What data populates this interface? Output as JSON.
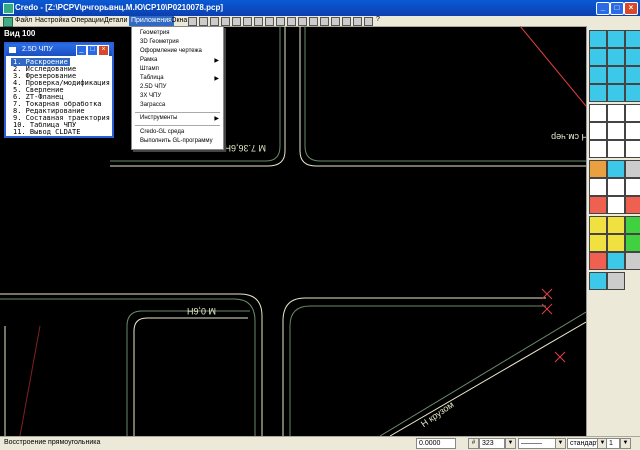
{
  "window": {
    "app_name": "Credo",
    "title_separator": "-",
    "document_path": "[Z:\\PCPV\\рчгорьвнц.М.Ю\\CP10\\P0210078.pcp]",
    "title_full": "Credo - [Z:\\PCPV\\рчгорьвнц.М.Ю\\CP10\\P0210078.pcp]"
  },
  "menubar": {
    "items": [
      "Файл",
      "Настройка",
      "Операции",
      "Детали",
      "Приложения",
      "Окна"
    ],
    "active": "Приложения",
    "help_label": "?"
  },
  "applications_menu": {
    "items": [
      {
        "label": "Геометрия",
        "submenu": false
      },
      {
        "label": "3D Геометрия",
        "submenu": false
      },
      {
        "label": "Оформление чертежа",
        "submenu": false
      },
      {
        "label": "Рамка",
        "submenu": true
      },
      {
        "label": "Штамп",
        "submenu": false
      },
      {
        "label": "Таблица",
        "submenu": true
      },
      {
        "label": "2.5D ЧПУ",
        "submenu": false
      },
      {
        "label": "3X ЧПУ",
        "submenu": false
      },
      {
        "label": "Заграсса",
        "submenu": false
      }
    ],
    "items2": [
      {
        "label": "Инструменты",
        "submenu": true
      }
    ],
    "items3": [
      {
        "label": "Credo-GL среда",
        "submenu": false
      },
      {
        "label": "Выполнить GL-программу",
        "submenu": false
      }
    ]
  },
  "view_label": "Вид 100",
  "cnc_window": {
    "title": "2.5D ЧПУ",
    "items": [
      "1. Раскроение",
      "2. Исследование",
      "3. Фрезерование",
      "4. Проверка/модификация",
      "5. Сверление",
      "6. ZT-Фланец",
      "7. Токарная обработка",
      "8. Редактирование",
      "9. Составная траектория",
      "10. Таблица ЧПУ",
      "11. Вывод CLDATE"
    ],
    "selected_index": 0
  },
  "drawing": {
    "labels": [
      "М 7.36,6Н см.чер",
      "Н см.чер",
      "М 0,6Н",
      "Н крузом"
    ]
  },
  "statusbar": {
    "message": "Восстроение прямоугольника",
    "coordinate": "0.0000",
    "layer": "323",
    "style": "стандарт",
    "scale": "1"
  },
  "colors": {
    "titlebar": "#0b3fb0",
    "menubar": "#ece9d8",
    "selection": "#316ac5",
    "canvas": "#000000",
    "drawing_line": "#e8e8c8",
    "accent_line": "#e04040"
  }
}
